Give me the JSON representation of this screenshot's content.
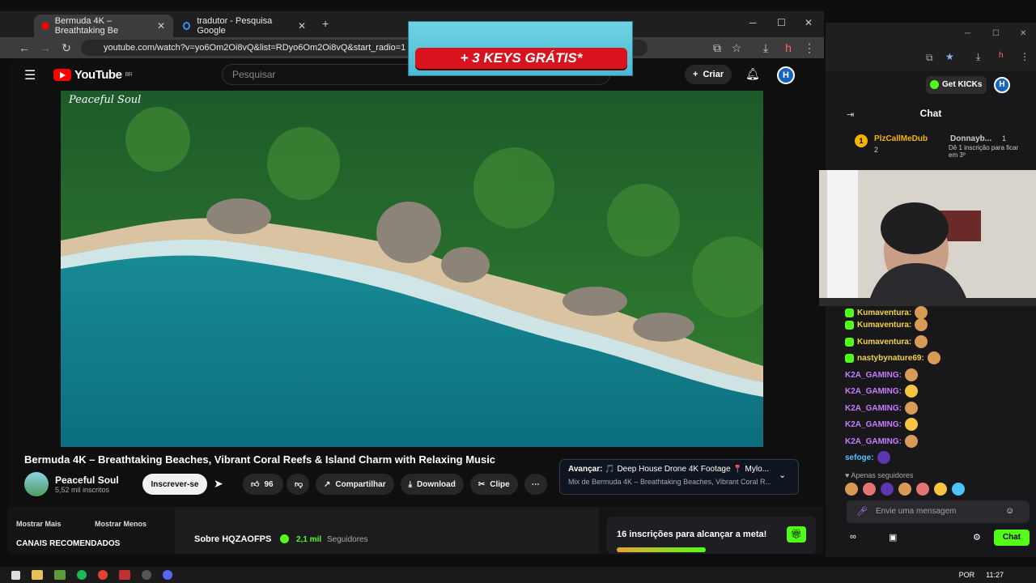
{
  "browser": {
    "tabs": [
      {
        "title": "Bermuda 4K – Breathtaking Be"
      },
      {
        "title": "tradutor - Pesquisa Google"
      }
    ],
    "url": "youtube.com/watch?v=yo6Om2Oi8vQ&list=RDyo6Om2Oi8vQ&start_radio=1"
  },
  "youtube": {
    "logo": "YouTube",
    "region": "BR",
    "search_placeholder": "Pesquisar",
    "create_label": "Criar",
    "video_watermark": "Peaceful Soul",
    "video_title": "Bermuda 4K – Breathtaking Beaches, Vibrant Coral Reefs & Island Charm with Relaxing Music",
    "channel_name": "Peaceful Soul",
    "subscribers": "5,52 mil inscritos",
    "subscribe_label": "Inscrever-se",
    "likes": "96",
    "share_label": "Compartilhar",
    "download_label": "Download",
    "clip_label": "Clipe",
    "next_label": "Avançar:",
    "next_title": "🎵 Deep House Drone 4K Footage 📍 Mylo...",
    "next_mix": "Mix de Bermuda 4K – Breathtaking Beaches, Vibrant Coral R..."
  },
  "bottom": {
    "show_more": "Mostrar Mais",
    "show_less": "Mostrar Menos",
    "recommended": "CANAIS RECOMENDADOS",
    "about": "Sobre HQZAOFPS",
    "followers_count": "2,1 mil",
    "followers_label": "Seguidores",
    "goal": "16 inscrições para alcançar a meta!"
  },
  "ad": {
    "text": "+ 3 KEYS GRÁTIS*"
  },
  "kick": {
    "get_kicks": "Get KICKs",
    "chat_title": "Chat",
    "leader1": "PlzCallMeDub",
    "leader1_count": "2",
    "leader1_rank": "1",
    "leader2": "Donnayb...",
    "leader2_count": "1",
    "leader2_note": "Dê 1 inscrição para ficar em 3º",
    "messages": [
      {
        "user": "Kumaventura:"
      },
      {
        "user": "Kumaventura:"
      },
      {
        "user": "Kumaventura:"
      },
      {
        "user": "nastybynature69:"
      },
      {
        "user": "K2A_GAMING:"
      },
      {
        "user": "K2A_GAMING:"
      },
      {
        "user": "K2A_GAMING:"
      },
      {
        "user": "K2A_GAMING:"
      },
      {
        "user": "K2A_GAMING:"
      },
      {
        "user": "sefoge:"
      }
    ],
    "followers_only": "Apenas seguidores",
    "input_placeholder": "Envie uma mensagem",
    "chat_button": "Chat"
  },
  "taskbar": {
    "lang": "POR",
    "time": "11:27"
  }
}
